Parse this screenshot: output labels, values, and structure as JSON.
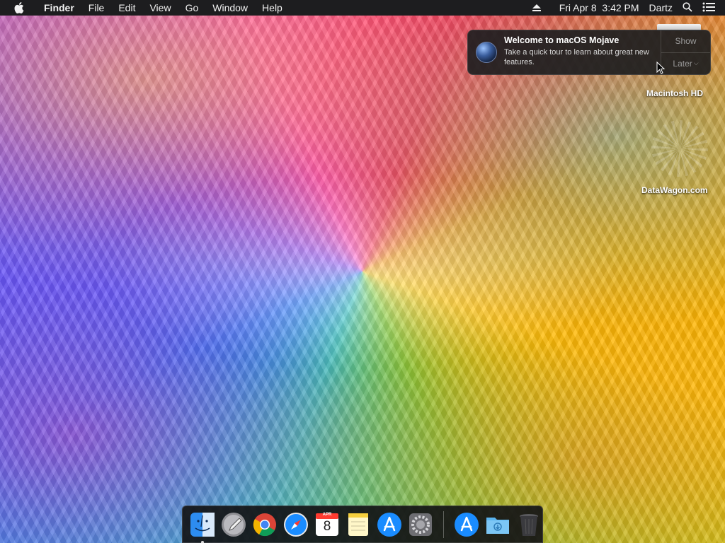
{
  "menubar": {
    "app_name": "Finder",
    "items": [
      "File",
      "Edit",
      "View",
      "Go",
      "Window",
      "Help"
    ],
    "clock": "Fri Apr 8  3:42 PM",
    "user": "Dartz"
  },
  "notification": {
    "title": "Welcome to macOS Mojave",
    "text": "Take a quick tour to learn about great new features.",
    "show_label": "Show",
    "later_label": "Later",
    "later_chevron": "⌵"
  },
  "desktop": {
    "volume_label": "Macintosh HD",
    "watermark_text": "DataWagon.com"
  },
  "dock": {
    "calendar": {
      "month": "APR",
      "day": "8"
    },
    "apps": [
      "finder",
      "launchpad",
      "chrome",
      "safari",
      "calendar",
      "notes",
      "app-store",
      "system-preferences"
    ],
    "right_items": [
      "app-store",
      "downloads",
      "trash"
    ]
  },
  "colors": {
    "menubar_bg": "#1d1d1f",
    "notification_bg": "#1e1e20",
    "dock_bg": "#141416"
  }
}
